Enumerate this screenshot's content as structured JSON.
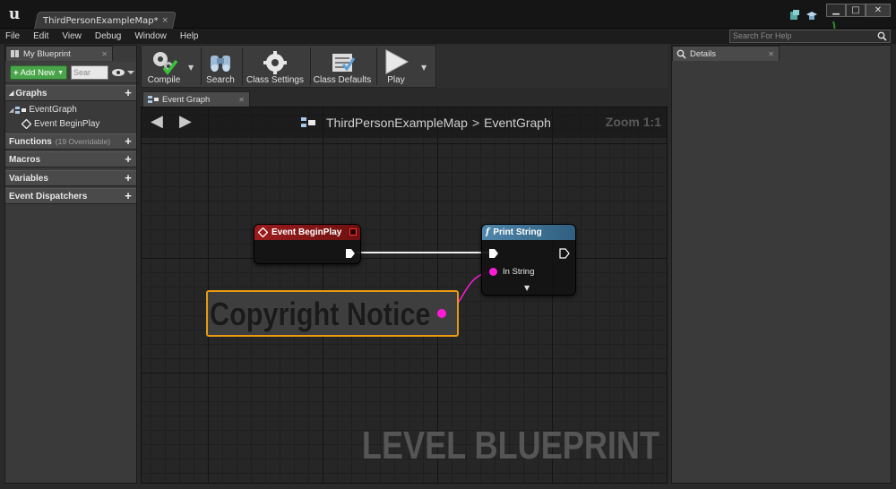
{
  "window": {
    "tab_title": "ThirdPersonExampleMap*",
    "tab_close": "×",
    "buttons": {
      "minimize": "▁",
      "maximize": "□",
      "close": "✕"
    }
  },
  "menu": {
    "items": [
      "File",
      "Edit",
      "View",
      "Debug",
      "Window",
      "Help"
    ],
    "search_placeholder": "Search For Help"
  },
  "my_blueprint": {
    "tab_label": "My Blueprint",
    "add_new_label": "Add New",
    "search_placeholder": "Sear",
    "sections": {
      "graphs": "Graphs",
      "functions": "Functions",
      "functions_sub": "(19 Overridable)",
      "macros": "Macros",
      "variables": "Variables",
      "event_dispatchers": "Event Dispatchers"
    },
    "tree": {
      "event_graph": "EventGraph",
      "event_begin_play": "Event BeginPlay"
    }
  },
  "toolbar": {
    "compile": "Compile",
    "search": "Search",
    "class_settings": "Class Settings",
    "class_defaults": "Class Defaults",
    "play": "Play"
  },
  "graph_editor": {
    "tab_label": "Event Graph",
    "breadcrumb_map": "ThirdPersonExampleMap",
    "breadcrumb_sep": ">",
    "breadcrumb_graph": "EventGraph",
    "zoom": "Zoom 1:1",
    "watermark": "LEVEL BLUEPRINT",
    "nodes": {
      "begin_play_title": "Event BeginPlay",
      "print_string_title": "Print String",
      "in_string_label": "In String",
      "comment_text": "Copyright Notice"
    }
  },
  "details": {
    "tab_label": "Details"
  },
  "colors": {
    "event_header": "#8b1a1a",
    "function_header": "#4a7fa0",
    "string_pin": "#ff1bd6",
    "comment_border": "#e89b12",
    "add_new": "#4aa54a"
  }
}
